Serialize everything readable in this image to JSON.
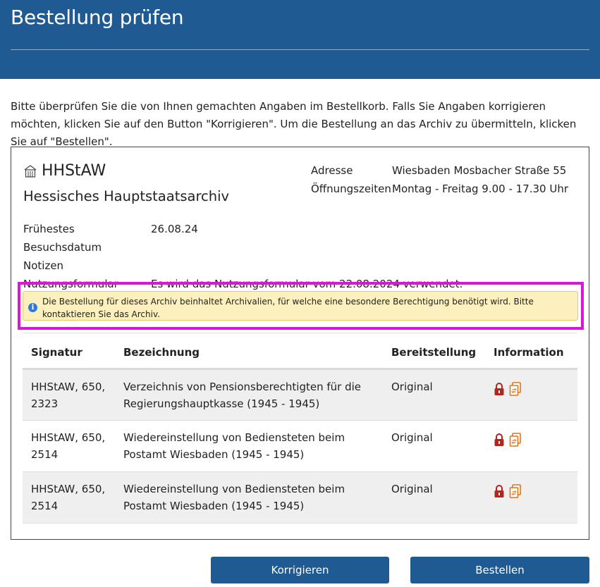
{
  "page": {
    "title": "Bestellung prüfen",
    "intro": "Bitte überprüfen Sie die von Ihnen gemachten Angaben im Bestellkorb. Falls Sie Angaben korrigieren möchten, klicken Sie auf den Button \"Korrigieren\". Um die Bestellung an das Archiv zu übermitteln, klicken Sie auf \"Bestellen\"."
  },
  "archive": {
    "code": "HHStAW",
    "name": "Hessisches Hauptstaatsarchiv",
    "icon": "building-icon",
    "address_label": "Adresse",
    "address_value": "Wiesbaden Mosbacher Straße 55",
    "hours_label": "Öffnungszeiten",
    "hours_value": "Montag - Freitag 9.00 - 17.30 Uhr",
    "visit_label": "Frühestes Besuchsdatum",
    "visit_value": "26.08.24",
    "notes_label": "Notizen",
    "notes_value": "",
    "form_label": "Nutzungsformular",
    "form_value": "Es wird das Nutzungsformular vom 22.08.2024 verwendet."
  },
  "warning": {
    "text": "Die Bestellung für dieses Archiv beinhaltet Archivalien, für welche eine besondere Berechtigung benötigt wird. Bitte kontaktieren Sie das Archiv.",
    "icon": "info-icon",
    "color": "#fbf0be"
  },
  "table": {
    "headers": [
      "Signatur",
      "Bezeichnung",
      "Bereitstellung",
      "Information"
    ],
    "rows": [
      {
        "signatur": "HHStAW, 650, 2323",
        "bezeichnung": "Verzeichnis von Pensionsberechtigten für die Regierungshauptkasse (1945 - 1945)",
        "bereitstellung": "Original"
      },
      {
        "signatur": "HHStAW, 650, 2514",
        "bezeichnung": "Wiedereinstellung von Bediensteten beim Postamt Wiesbaden (1945 - 1945)",
        "bereitstellung": "Original"
      },
      {
        "signatur": "HHStAW, 650, 2514",
        "bezeichnung": "Wiedereinstellung von Bediensteten beim Postamt Wiesbaden (1945 - 1945)",
        "bereitstellung": "Original"
      }
    ],
    "row_icons": [
      "lock-icon",
      "document-copy-icon"
    ]
  },
  "buttons": {
    "korrigieren": "Korrigieren",
    "bestellen": "Bestellen"
  },
  "colors": {
    "brand": "#1f5a92",
    "highlight": "#dc16d6",
    "lock": "#b3261e",
    "doc": "#e0741c"
  }
}
